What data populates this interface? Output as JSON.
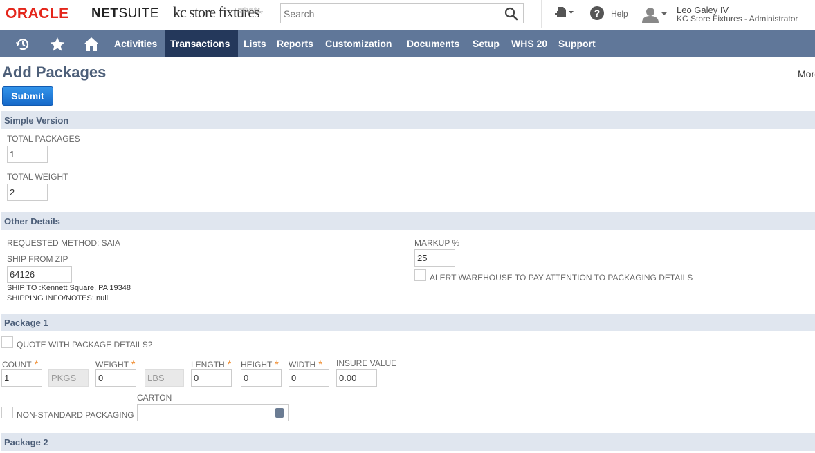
{
  "header": {
    "logo_oracle": "ORACLE",
    "logo_netsuite_bold": "NET",
    "logo_netsuite_rest": "SUITE",
    "logo_kc": "kc store fixtures",
    "logo_kc_tagline": "quality service value on display",
    "search_placeholder": "Search",
    "help_label": "Help",
    "user_name": "Leo Galey IV",
    "user_role": "KC Store Fixtures - Administrator"
  },
  "nav": {
    "items": [
      {
        "label": "Activities"
      },
      {
        "label": "Transactions"
      },
      {
        "label": "Lists"
      },
      {
        "label": "Reports"
      },
      {
        "label": "Customization"
      },
      {
        "label": "Documents"
      },
      {
        "label": "Setup"
      },
      {
        "label": "WHS 20"
      },
      {
        "label": "Support"
      }
    ],
    "active": "Transactions"
  },
  "page": {
    "title": "Add Packages",
    "more_label": "More",
    "submit_label": "Submit"
  },
  "simple_version": {
    "heading": "Simple Version",
    "total_packages_label": "TOTAL PACKAGES",
    "total_packages_value": "1",
    "total_weight_label": "TOTAL WEIGHT",
    "total_weight_value": "2"
  },
  "other_details": {
    "heading": "Other Details",
    "requested_method": "REQUESTED METHOD: SAIA",
    "ship_from_zip_label": "SHIP FROM ZIP",
    "ship_from_zip_value": "64126",
    "ship_to": "SHIP TO :Kennett Square, PA 19348",
    "shipping_info": "SHIPPING INFO/NOTES: null",
    "markup_label": "MARKUP %",
    "markup_value": "25",
    "alert_label": "ALERT WAREHOUSE TO PAY ATTENTION TO PACKAGING DETAILS"
  },
  "package1": {
    "heading": "Package 1",
    "quote_label": "QUOTE WITH PACKAGE DETAILS?",
    "count_label": "COUNT",
    "count_value": "1",
    "count_unit": "PKGS",
    "weight_label": "WEIGHT",
    "weight_value": "0",
    "weight_unit": "LBS",
    "length_label": "LENGTH",
    "length_value": "0",
    "height_label": "HEIGHT",
    "height_value": "0",
    "width_label": "WIDTH",
    "width_value": "0",
    "insure_label": "INSURE VALUE",
    "insure_value": "0.00",
    "nonstandard_label": "NON-STANDARD PACKAGING",
    "carton_label": "CARTON",
    "carton_value": ""
  },
  "package2": {
    "heading": "Package 2"
  },
  "colors": {
    "nav_bg": "#607799",
    "nav_active": "#24385b",
    "section_bg": "#e0e6ef",
    "title": "#4d5f79",
    "required": "#f08a2b",
    "submit": "#1f7dd6"
  }
}
